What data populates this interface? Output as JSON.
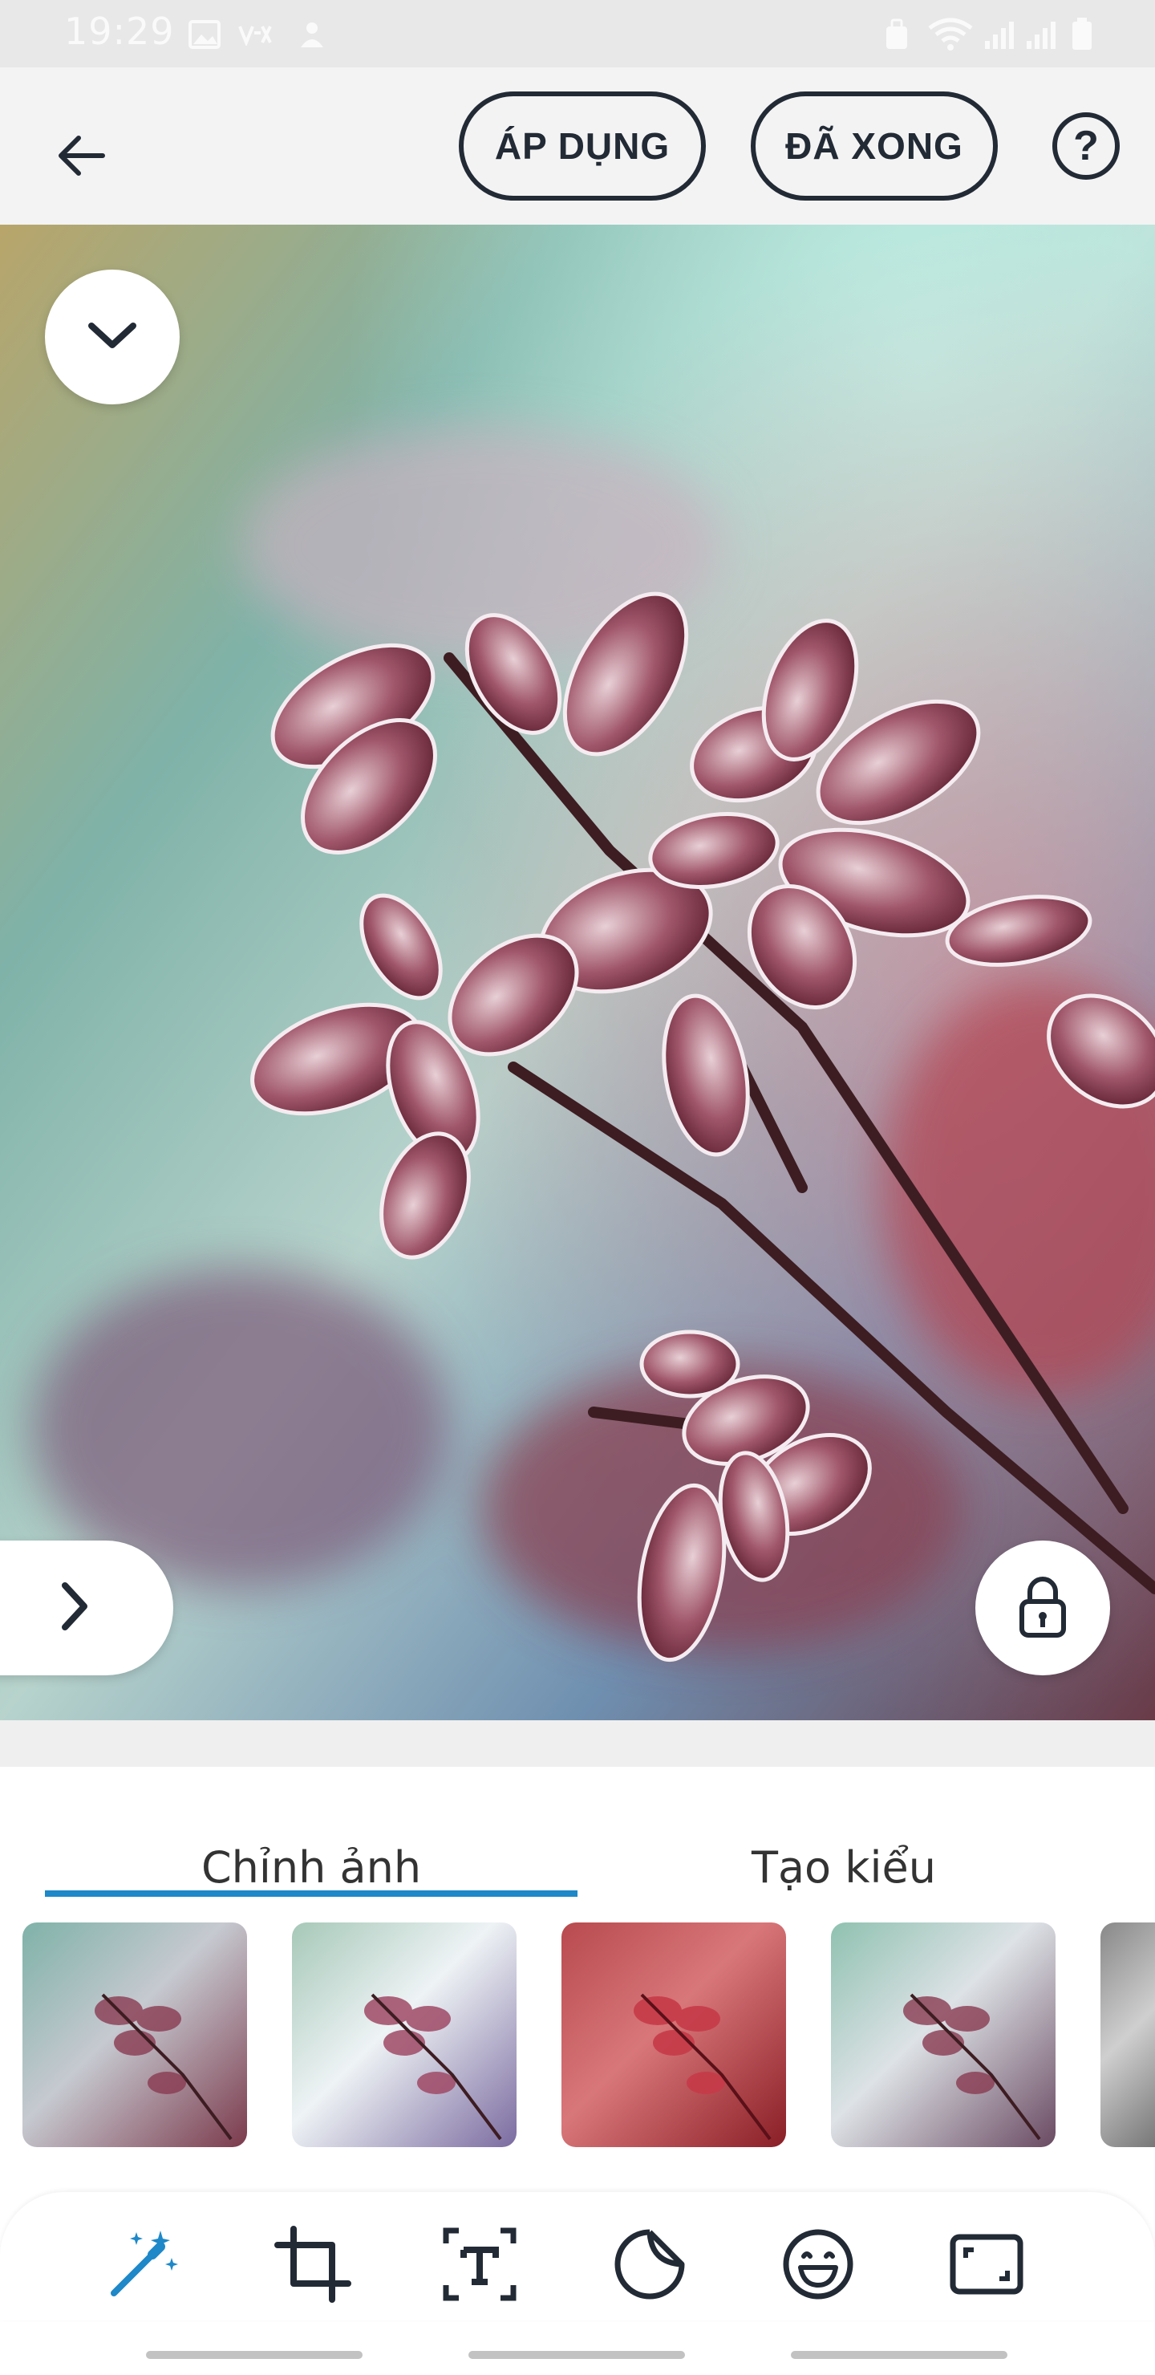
{
  "status": {
    "time": "19:29",
    "icons": [
      "image-icon",
      "vtv-icon",
      "notification-icon",
      "lock-screen-icon",
      "wifi-icon",
      "signal-1-icon",
      "signal-2-icon",
      "battery-icon"
    ]
  },
  "toolbar": {
    "back_icon": "back-arrow-icon",
    "apply_label": "ÁP DỤNG",
    "done_label": "ĐÃ XONG",
    "help_label": "?"
  },
  "photo": {
    "collapse_icon": "chevron-down-icon",
    "next_icon": "chevron-right-icon",
    "lock_icon": "lock-icon"
  },
  "tabs": [
    {
      "label": "Chỉnh ảnh",
      "active": true
    },
    {
      "label": "Tạo kiểu",
      "active": false
    }
  ],
  "presets": [
    "preset-1",
    "preset-2",
    "preset-3",
    "preset-4",
    "preset-5"
  ],
  "tools": [
    {
      "name": "magic-wand-icon",
      "active": true,
      "color": "#1e88c8"
    },
    {
      "name": "crop-icon",
      "active": false,
      "color": "#222a35"
    },
    {
      "name": "text-icon",
      "active": false,
      "color": "#222a35"
    },
    {
      "name": "sticker-icon",
      "active": false,
      "color": "#222a35"
    },
    {
      "name": "emoji-icon",
      "active": false,
      "color": "#222a35"
    },
    {
      "name": "frame-icon",
      "active": false,
      "color": "#222a35"
    }
  ],
  "colors": {
    "accent": "#1e88c8",
    "ink": "#222a35"
  }
}
